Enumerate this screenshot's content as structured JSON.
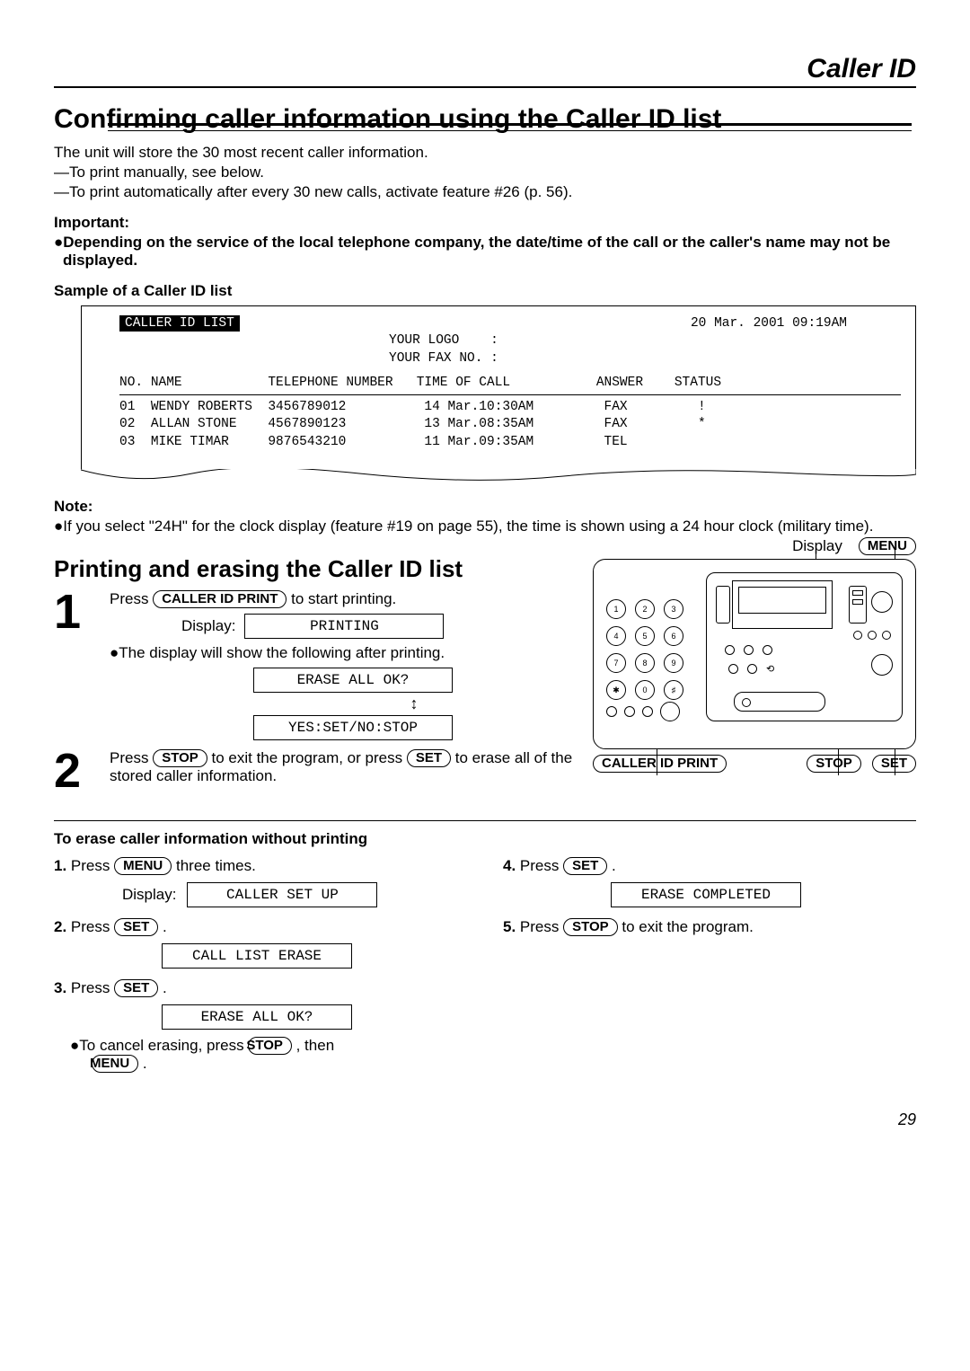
{
  "header": {
    "section": "Caller ID"
  },
  "title": "Confirming caller information using the Caller ID list",
  "intro": {
    "l1": "The unit will store the 30 most recent caller information.",
    "l2": "—To print manually, see below.",
    "l3": "—To print automatically after every 30 new calls, activate feature #26 (p. 56)."
  },
  "important": {
    "head": "Important:",
    "body": "●Depending on the service of the local telephone company, the date/time of the call or the caller's name may not be displayed."
  },
  "sample": {
    "head": "Sample of a Caller ID list",
    "title": "CALLER ID LIST",
    "datetime": "20 Mar. 2001 09:19AM",
    "logo_label": "YOUR LOGO    :",
    "fax_label": "YOUR FAX NO. :",
    "cols": {
      "no": "NO.",
      "name": "NAME",
      "tel": "TELEPHONE NUMBER",
      "time": "TIME OF CALL",
      "answer": "ANSWER",
      "status": "STATUS"
    },
    "rows": [
      {
        "no": "01",
        "name": "WENDY ROBERTS",
        "tel": "3456789012",
        "time": "14 Mar.10:30AM",
        "answer": "FAX",
        "status": "!"
      },
      {
        "no": "02",
        "name": "ALLAN STONE",
        "tel": "4567890123",
        "time": "13 Mar.08:35AM",
        "answer": "FAX",
        "status": "*"
      },
      {
        "no": "03",
        "name": "MIKE TIMAR",
        "tel": "9876543210",
        "time": "11 Mar.09:35AM",
        "answer": "TEL",
        "status": ""
      }
    ]
  },
  "note": {
    "head": "Note:",
    "body": "●If you select \"24H\" for the clock display (feature #19 on page 55), the time is shown using a 24 hour clock (military time)."
  },
  "subhead": "Printing and erasing the Caller ID list",
  "device": {
    "display_label": "Display",
    "menu": "MENU",
    "cid_print": "CALLER ID PRINT",
    "stop": "STOP",
    "set": "SET"
  },
  "step1": {
    "press": "Press ",
    "key": "CALLER ID PRINT",
    "after": " to start printing.",
    "display_label": "Display:",
    "lcd1": "PRINTING",
    "line2": "●The display will show the following after printing.",
    "lcd2": "ERASE ALL OK?",
    "lcd3": "YES:SET/NO:STOP"
  },
  "step2": {
    "t1": "Press ",
    "key1": "STOP",
    "t2": " to exit the program, or press ",
    "key2": "SET",
    "t3": " to erase all of the stored caller information."
  },
  "erase": {
    "head": "To erase caller information without printing",
    "s1": {
      "n": "1.",
      "t1": " Press ",
      "key": "MENU",
      "t2": " three times.",
      "display_label": "Display:",
      "lcd": "CALLER SET UP"
    },
    "s2": {
      "n": "2.",
      "t1": " Press ",
      "key": "SET",
      "t2": " .",
      "lcd": "CALL LIST ERASE"
    },
    "s3": {
      "n": "3.",
      "t1": " Press ",
      "key": "SET",
      "t2": " .",
      "lcd": "ERASE ALL OK?",
      "cancel1": "●To cancel erasing, press ",
      "cancel_key1": "STOP",
      "cancel2": " , then ",
      "cancel_key2": "MENU",
      "cancel3": " ."
    },
    "s4": {
      "n": "4.",
      "t1": " Press ",
      "key": "SET",
      "t2": " .",
      "lcd": "ERASE COMPLETED"
    },
    "s5": {
      "n": "5.",
      "t1": " Press ",
      "key": "STOP",
      "t2": " to exit the program."
    }
  },
  "page": "29"
}
